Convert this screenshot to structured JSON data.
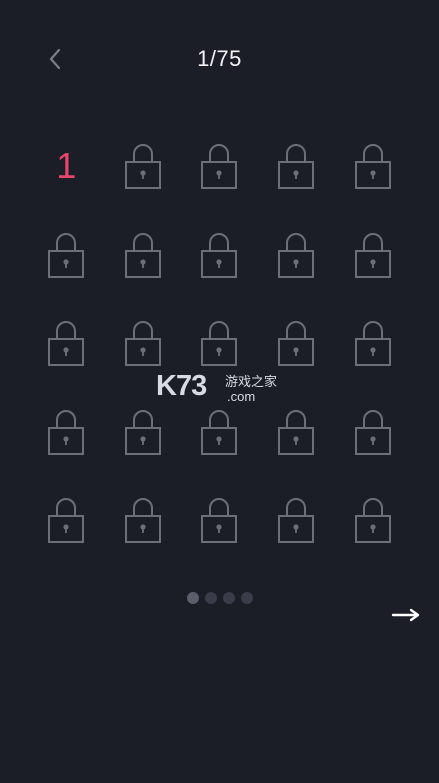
{
  "header": {
    "back_icon": "chevron-left-icon",
    "title": "1/75"
  },
  "grid": {
    "unlocked_level": "1",
    "locked_icon": "lock-icon",
    "cells": [
      {
        "type": "unlocked",
        "label": "1"
      },
      {
        "type": "locked"
      },
      {
        "type": "locked"
      },
      {
        "type": "locked"
      },
      {
        "type": "locked"
      },
      {
        "type": "locked"
      },
      {
        "type": "locked"
      },
      {
        "type": "locked"
      },
      {
        "type": "locked"
      },
      {
        "type": "locked"
      },
      {
        "type": "locked"
      },
      {
        "type": "locked"
      },
      {
        "type": "locked"
      },
      {
        "type": "locked"
      },
      {
        "type": "locked"
      },
      {
        "type": "locked"
      },
      {
        "type": "locked"
      },
      {
        "type": "locked"
      },
      {
        "type": "locked"
      },
      {
        "type": "locked"
      },
      {
        "type": "locked"
      },
      {
        "type": "locked"
      },
      {
        "type": "locked"
      },
      {
        "type": "locked"
      },
      {
        "type": "locked"
      }
    ]
  },
  "watermark": {
    "logo": "K73",
    "cn_text": "游戏之家",
    "domain": ".com"
  },
  "pager": {
    "total_pages": 4,
    "current_page": 1
  },
  "footer": {
    "next_icon": "arrow-right-icon"
  },
  "colors": {
    "background": "#1b1d27",
    "accent": "#e8456d",
    "lock": "#6c6f7a",
    "title": "#f2f2f5"
  }
}
